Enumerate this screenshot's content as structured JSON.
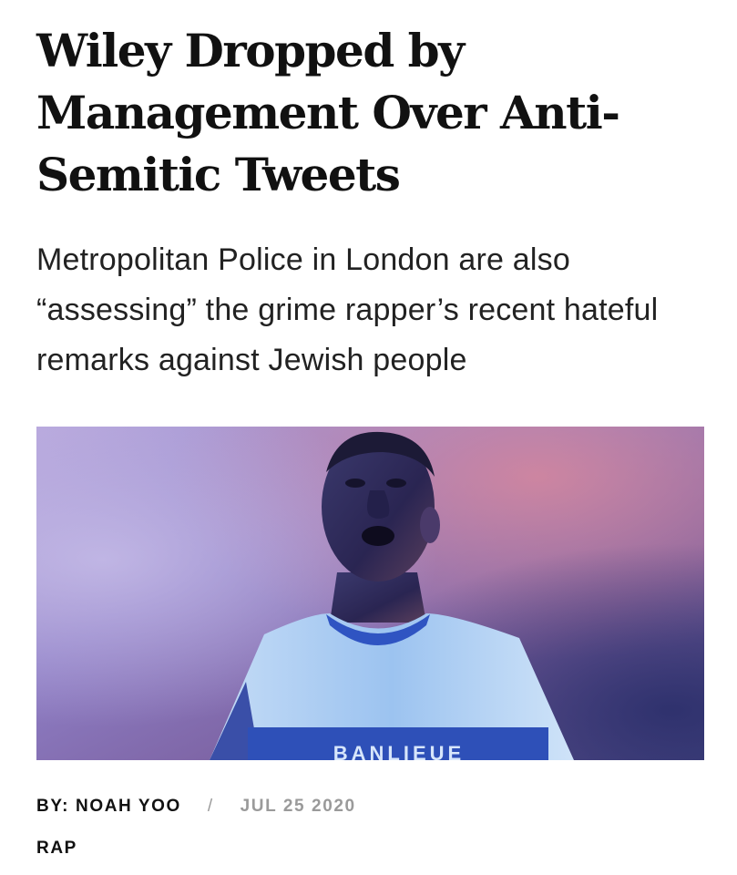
{
  "article": {
    "headline": "Wiley Dropped by Management Over Anti-Semitic Tweets",
    "dek": "Metropolitan Police in London are also “assessing” the grime rapper’s recent hateful remarks against Jewish people",
    "hero_image": {
      "shirt_text": "BANLIEUE"
    },
    "byline": {
      "prefix": "BY:",
      "author": "NOAH YOO",
      "separator": "/",
      "date": "JUL 25 2020"
    },
    "category": "RAP"
  },
  "colors": {
    "text": "#111111",
    "meta_gray": "#9a9a9a"
  }
}
